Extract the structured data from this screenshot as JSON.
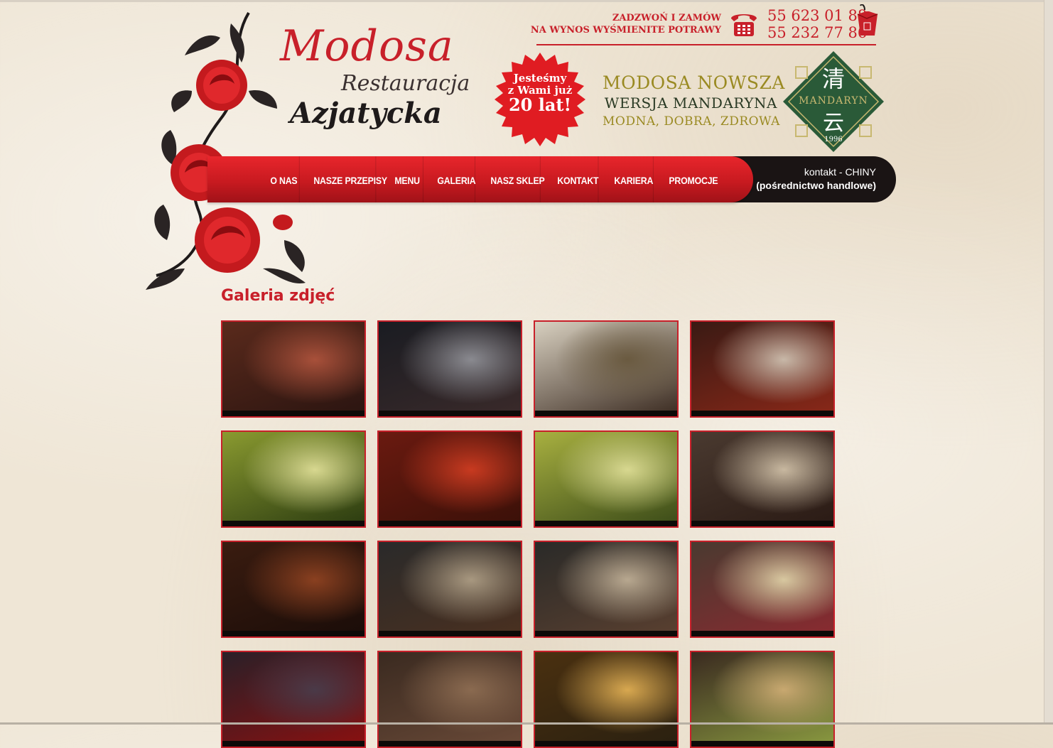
{
  "logo": {
    "line1": "Modosa",
    "line2": "Restauracja",
    "line3": "Azjatycka"
  },
  "order": {
    "line1": "ZADZWOŃ I ZAMÓW",
    "line2": "NA WYNOS WYŚMIENITE POTRAWY",
    "phone1": "55 623 01 88",
    "phone2": "55 232 77 86"
  },
  "badge": {
    "line1": "Jesteśmy",
    "line2": "z Wami już",
    "line3": "20 lat!"
  },
  "mandaryn": {
    "line1": "MODOSA NOWSZA",
    "line2": "WERSJA MANDARYNA",
    "line3": "MODNA, DOBRA, ZDROWA",
    "logo_text": "MANDARYN",
    "logo_year": "1996",
    "logo_char_top": "清",
    "logo_char_bottom": "云"
  },
  "nav": {
    "items": [
      "O NAS",
      "NASZE PRZEPISY",
      "MENU",
      "GALERIA",
      "NASZ SKLEP",
      "KONTAKT",
      "KARIERA",
      "PROMOCJE"
    ]
  },
  "contact": {
    "line1": "kontakt - CHINY",
    "line2": "(pośrednictwo handlowe)"
  },
  "gallery": {
    "title": "Galeria zdjęć",
    "photos": [
      {
        "tone": [
          "#5a2a1c",
          "#a8503a",
          "#2a1410"
        ]
      },
      {
        "tone": [
          "#1a1c22",
          "#8a8a90",
          "#3a2a2a"
        ]
      },
      {
        "tone": [
          "#d8d0c0",
          "#6a5a40",
          "#3a2a20"
        ]
      },
      {
        "tone": [
          "#3a1a14",
          "#c8b8a8",
          "#8a2818"
        ]
      },
      {
        "tone": [
          "#8a9a30",
          "#d8d890",
          "#2a3a10"
        ]
      },
      {
        "tone": [
          "#6a1a10",
          "#c83a20",
          "#3a1008"
        ]
      },
      {
        "tone": [
          "#a8b040",
          "#d8d890",
          "#3a4a18"
        ]
      },
      {
        "tone": [
          "#4a3a30",
          "#c8b8a0",
          "#2a1a14"
        ]
      },
      {
        "tone": [
          "#3a1c10",
          "#8a4020",
          "#1a0c08"
        ]
      },
      {
        "tone": [
          "#2a2a2a",
          "#a89880",
          "#4a3020"
        ]
      },
      {
        "tone": [
          "#2a2a28",
          "#b8a890",
          "#5a4030"
        ]
      },
      {
        "tone": [
          "#4a3a30",
          "#d8c8a0",
          "#8a2a30"
        ]
      },
      {
        "tone": [
          "#2a2028",
          "#4a3a48",
          "#8a1010"
        ]
      },
      {
        "tone": [
          "#3a2a20",
          "#8a6a50",
          "#6a4a38"
        ]
      },
      {
        "tone": [
          "#4a3010",
          "#d8a850",
          "#2a2010"
        ]
      },
      {
        "tone": [
          "#3a2a20",
          "#c8a870",
          "#8a9a40"
        ]
      }
    ]
  }
}
